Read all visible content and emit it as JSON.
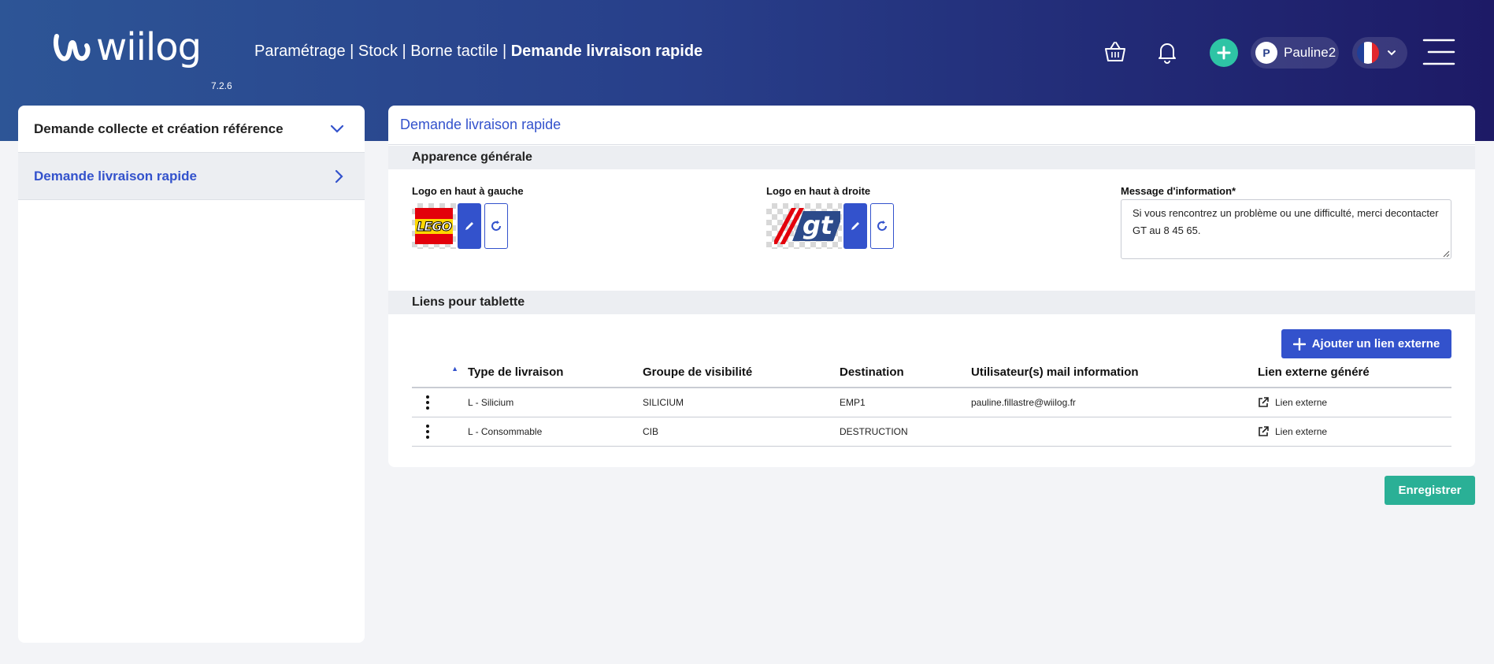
{
  "app": {
    "brand": "wiilog",
    "version": "7.2.6"
  },
  "breadcrumb": {
    "path": "Paramétrage | Stock | Borne tactile | ",
    "current": "Demande livraison rapide"
  },
  "header": {
    "icons": [
      "basket-icon",
      "bell-icon",
      "plus-icon",
      "menu-icon"
    ],
    "user": {
      "initial": "P",
      "name": "Pauline2"
    },
    "language": {
      "flag_colors": [
        "#1f3f99",
        "#ffffff",
        "#e2262c"
      ]
    }
  },
  "sidebar": {
    "items": [
      {
        "label": "Demande collecte et création référence",
        "icon": "chevron-down-icon"
      },
      {
        "label": "Demande livraison rapide",
        "icon": "chevron-right-icon"
      }
    ]
  },
  "main": {
    "title": "Demande livraison rapide",
    "sections": {
      "appearance": "Apparence générale",
      "links": "Liens pour tablette"
    },
    "logo_left": {
      "label": "Logo en haut à gauche",
      "text": "LEGO"
    },
    "logo_right": {
      "label": "Logo en haut à droite",
      "text": "gt"
    },
    "info_message": {
      "label": "Message d'information*",
      "value": "Si vous rencontrez un problème ou une difficulté, merci decontacter GT au 8 45 65."
    },
    "add_link_label": "Ajouter un lien externe",
    "table": {
      "columns": [
        "Type de livraison",
        "Groupe de visibilité",
        "Destination",
        "Utilisateur(s) mail information",
        "Lien externe généré"
      ],
      "rows": [
        {
          "type": "L - Silicium",
          "group": "SILICIUM",
          "destination": "EMP1",
          "users": "pauline.fillastre@wiilog.fr",
          "link": "Lien externe"
        },
        {
          "type": "L - Consommable",
          "group": "CIB",
          "destination": "DESTRUCTION",
          "users": "",
          "link": "Lien externe"
        }
      ]
    },
    "save_label": "Enregistrer"
  },
  "colors": {
    "accent": "#3352cc",
    "success": "#2ab096",
    "header_start": "#2d5596",
    "header_end": "#1d1a66"
  }
}
